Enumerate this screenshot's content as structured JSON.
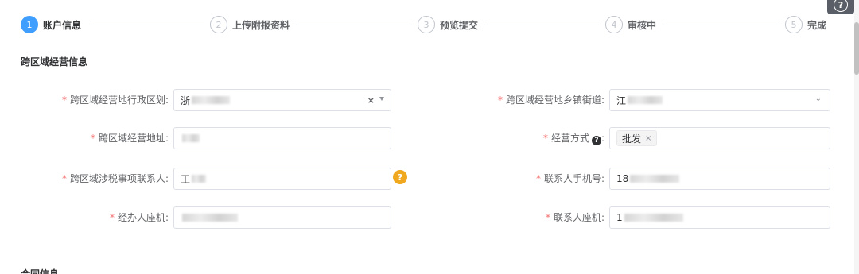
{
  "steps": [
    {
      "num": "1",
      "label": "账户信息"
    },
    {
      "num": "2",
      "label": "上传附报资料"
    },
    {
      "num": "3",
      "label": "预览提交"
    },
    {
      "num": "4",
      "label": "审核中"
    },
    {
      "num": "5",
      "label": "完成"
    }
  ],
  "help_badge": "?",
  "sections": {
    "cross_region": "跨区域经营信息",
    "contract": "合同信息"
  },
  "form": {
    "admin_region": {
      "required": "*",
      "label": "跨区域经营地行政区划:",
      "value": "浙",
      "clear": "×"
    },
    "street": {
      "required": "*",
      "label": "跨区域经营地乡镇街道:",
      "value": "江"
    },
    "address": {
      "required": "*",
      "label": "跨区域经营地址:",
      "value": ""
    },
    "mode": {
      "required": "*",
      "label": "经营方式",
      "label_suffix": ":",
      "tag": "批发",
      "tag_close": "×",
      "help": "?"
    },
    "contact": {
      "required": "*",
      "label": "跨区域涉税事项联系人:",
      "value": "王",
      "help": "?"
    },
    "phone": {
      "required": "*",
      "label": "联系人手机号:",
      "value": "18"
    },
    "handler_phone": {
      "required": "*",
      "label": "经办人座机:",
      "value": ""
    },
    "contact_landline": {
      "required": "*",
      "label": "联系人座机:",
      "value": "1"
    }
  }
}
